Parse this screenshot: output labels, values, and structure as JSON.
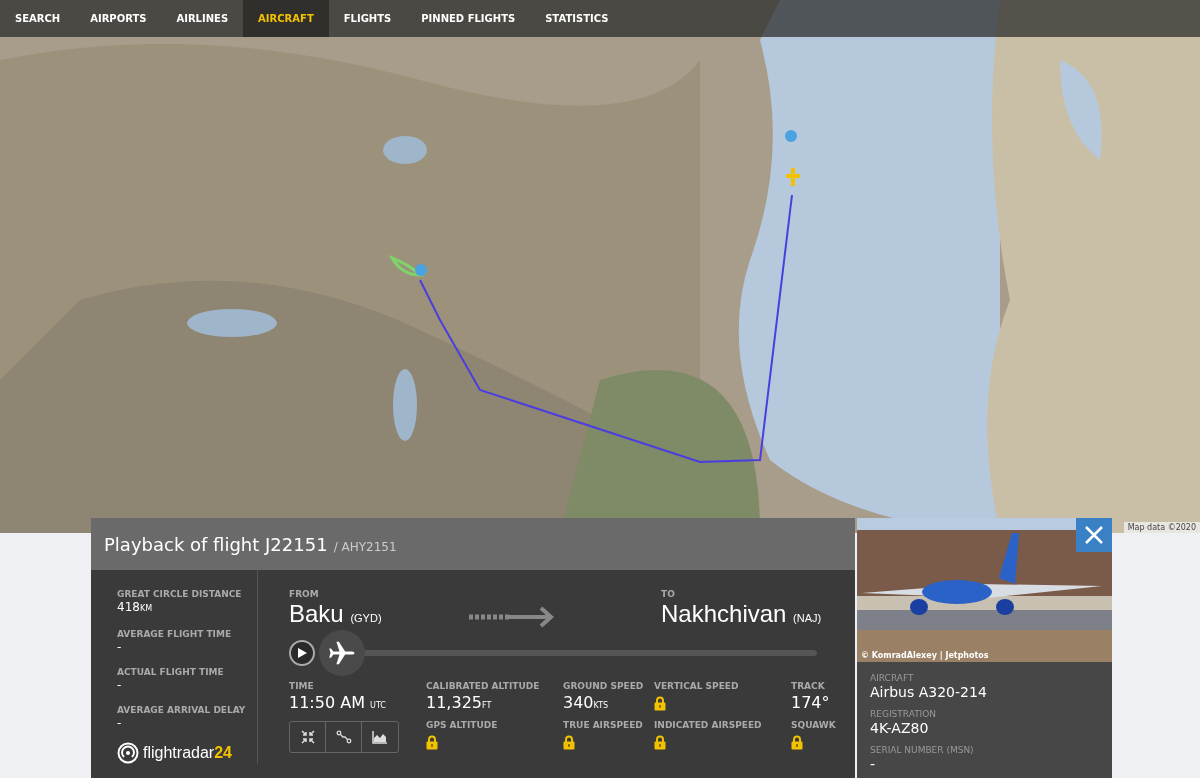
{
  "nav": [
    {
      "label": "SEARCH",
      "selected": false
    },
    {
      "label": "AIRPORTS",
      "selected": false
    },
    {
      "label": "AIRLINES",
      "selected": false
    },
    {
      "label": "AIRCRAFT",
      "selected": true
    },
    {
      "label": "FLIGHTS",
      "selected": false
    },
    {
      "label": "PINNED FLIGHTS",
      "selected": false
    },
    {
      "label": "STATISTICS",
      "selected": false
    }
  ],
  "map": {
    "attribution": "Map data ©2020"
  },
  "panel": {
    "title": "Playback of flight J22151",
    "subtitle": "/ AHY2151",
    "summary": [
      {
        "label": "GREAT CIRCLE DISTANCE",
        "value": "418",
        "unit": "KM"
      },
      {
        "label": "AVERAGE FLIGHT TIME",
        "value": "-"
      },
      {
        "label": "ACTUAL FLIGHT TIME",
        "value": "-"
      },
      {
        "label": "AVERAGE ARRIVAL DELAY",
        "value": "-"
      }
    ],
    "logo": {
      "text": "flightradar",
      "number": "24"
    },
    "from": {
      "label": "FROM",
      "city": "Baku",
      "code": "(GYD)"
    },
    "to": {
      "label": "TO",
      "city": "Nakhchivan",
      "code": "(NAJ)"
    },
    "playback": {
      "level": 0
    },
    "time": {
      "label": "TIME",
      "value": "11:50 AM",
      "unit": "UTC"
    },
    "stats": [
      {
        "label": "CALIBRATED ALTITUDE",
        "kind": "value",
        "value": "11,325",
        "unit": "FT"
      },
      {
        "label": "GROUND SPEED",
        "kind": "value",
        "value": "340",
        "unit": "KTS"
      },
      {
        "label": "VERTICAL SPEED",
        "kind": "locked"
      },
      {
        "label": "TRACK",
        "kind": "value",
        "value": "174°"
      },
      {
        "label": "GPS ALTITUDE",
        "kind": "locked"
      },
      {
        "label": "TRUE AIRSPEED",
        "kind": "locked"
      },
      {
        "label": "INDICATED AIRSPEED",
        "kind": "locked"
      },
      {
        "label": "SQUAWK",
        "kind": "locked"
      }
    ]
  },
  "aircraft": {
    "photo": {
      "credit": "© KomradAlexey | Jetphotos"
    },
    "fields": [
      {
        "label": "AIRCRAFT",
        "value": "Airbus A320-214"
      },
      {
        "label": "REGISTRATION",
        "value": "4K-AZ80"
      },
      {
        "label": "SERIAL NUMBER (MSN)",
        "value": "-"
      }
    ]
  }
}
